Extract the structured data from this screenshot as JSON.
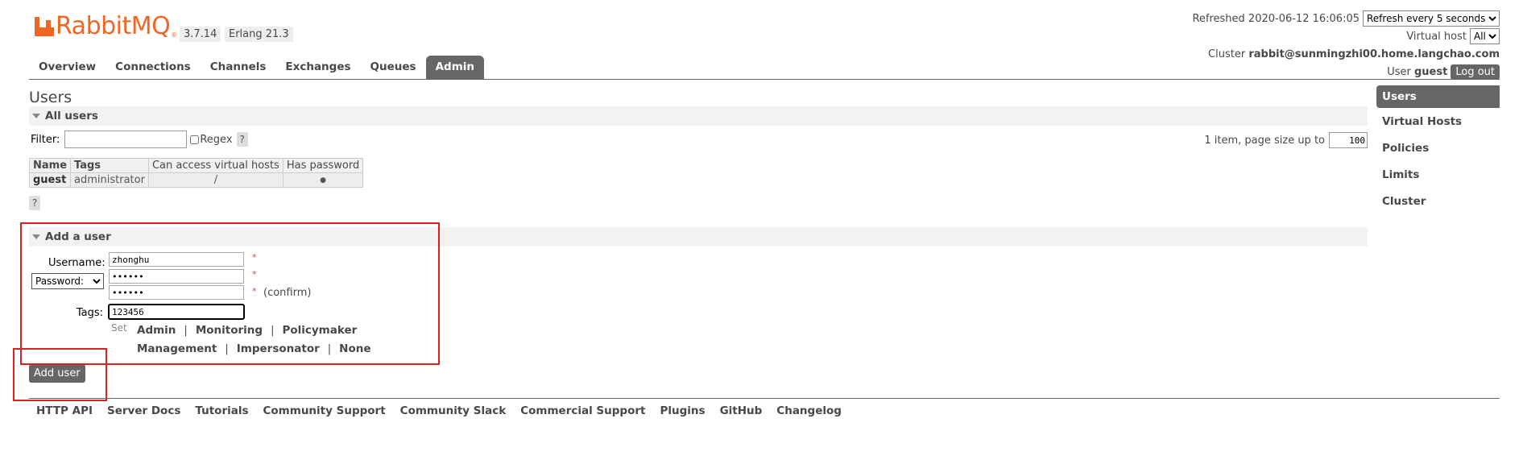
{
  "header": {
    "logo_text": "RabbitMQ",
    "logo_mark": "®",
    "version": "3.7.14",
    "erlang": "Erlang 21.3",
    "refreshed_label": "Refreshed 2020-06-12 16:06:05",
    "refresh_select": "Refresh every 5 seconds",
    "vhost_label": "Virtual host",
    "vhost_select": "All",
    "cluster_label": "Cluster",
    "cluster_value": "rabbit@sunmingzhi00.home.langchao.com",
    "user_label": "User",
    "user_value": "guest",
    "logout_label": "Log out"
  },
  "nav": {
    "tabs": [
      {
        "label": "Overview"
      },
      {
        "label": "Connections"
      },
      {
        "label": "Channels"
      },
      {
        "label": "Exchanges"
      },
      {
        "label": "Queues"
      },
      {
        "label": "Admin",
        "active": true
      }
    ]
  },
  "sidebar": {
    "items": [
      {
        "label": "Users",
        "active": true
      },
      {
        "label": "Virtual Hosts"
      },
      {
        "label": "Policies"
      },
      {
        "label": "Limits"
      },
      {
        "label": "Cluster"
      }
    ]
  },
  "main": {
    "title": "Users",
    "all_users": {
      "section_title": "All users",
      "filter_label": "Filter:",
      "filter_value": "",
      "regex_label": "Regex",
      "help": "?",
      "pagination_label": "1 item, page size up to",
      "page_size": "100",
      "table": {
        "columns": [
          "Name",
          "Tags",
          "Can access virtual hosts",
          "Has password"
        ],
        "rows": [
          {
            "name": "guest",
            "tags": "administrator",
            "vhosts": "/",
            "has_password": "●"
          }
        ]
      }
    },
    "add_user": {
      "section_title": "Add a user",
      "username_label": "Username:",
      "username_value": "zhonghu",
      "password_select": "Password:",
      "password_value": "••••••",
      "confirm_value": "••••••",
      "required": "*",
      "confirm_label": "(confirm)",
      "tags_label": "Tags:",
      "tags_value": "123456",
      "set_label": "Set",
      "tag_options": [
        "Admin",
        "Monitoring",
        "Policymaker",
        "Management",
        "Impersonator",
        "None"
      ],
      "separator": "|",
      "submit_label": "Add user"
    }
  },
  "footer": {
    "links": [
      "HTTP API",
      "Server Docs",
      "Tutorials",
      "Community Support",
      "Community Slack",
      "Commercial Support",
      "Plugins",
      "GitHub",
      "Changelog"
    ]
  },
  "colors": {
    "brand": "#f26522",
    "active_tab": "#666666",
    "annotation_box": "#e02020"
  }
}
